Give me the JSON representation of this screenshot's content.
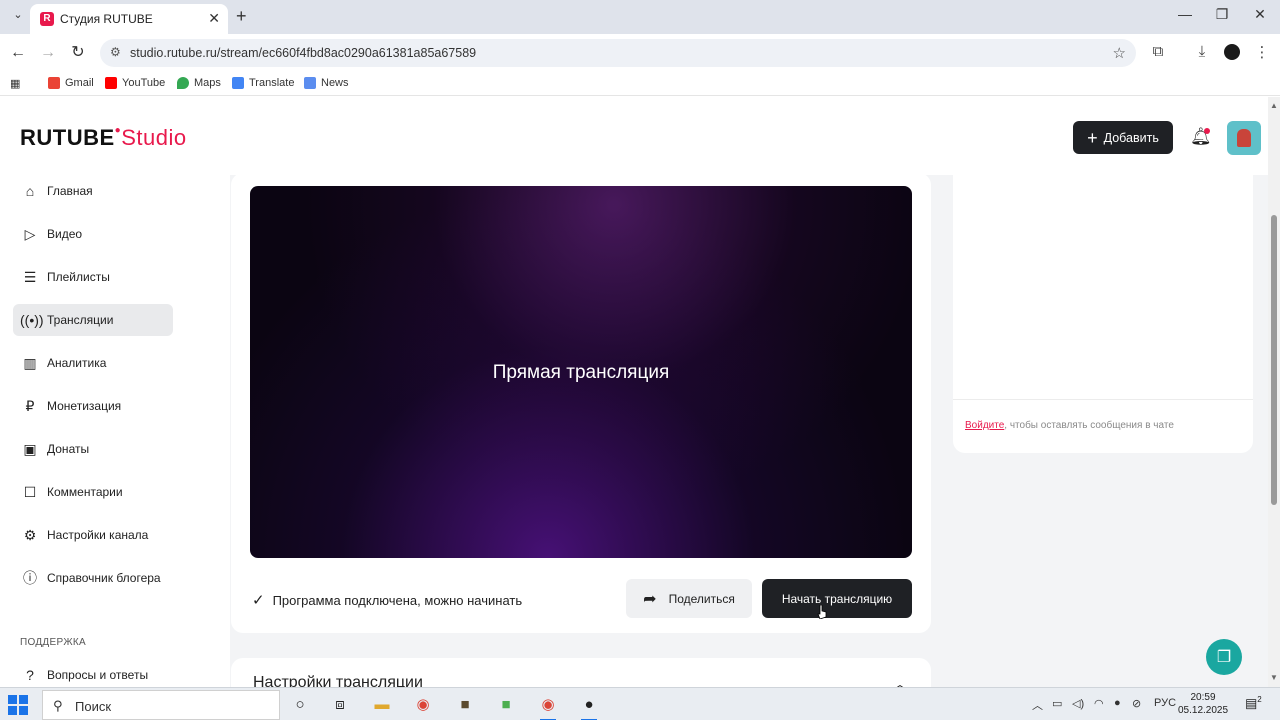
{
  "browser": {
    "tab_title": "Студия RUTUBE",
    "favicon": "R",
    "url": "studio.rutube.ru/stream/ec660f4fbd8ac0290a61381a85a67589",
    "bookmarks": [
      "Gmail",
      "YouTube",
      "Maps",
      "Translate",
      "News"
    ]
  },
  "header": {
    "logo_main": "RUTUBE",
    "logo_sub": "Studio",
    "add_label": "Добавить"
  },
  "sidebar": {
    "items": [
      {
        "label": "Главная",
        "icon": "home-icon"
      },
      {
        "label": "Видео",
        "icon": "video-icon"
      },
      {
        "label": "Плейлисты",
        "icon": "playlist-icon"
      },
      {
        "label": "Трансляции",
        "icon": "broadcast-icon",
        "active": true
      },
      {
        "label": "Аналитика",
        "icon": "analytics-icon"
      },
      {
        "label": "Монетизация",
        "icon": "monetization-icon"
      },
      {
        "label": "Донаты",
        "icon": "donations-icon"
      },
      {
        "label": "Комментарии",
        "icon": "comments-icon"
      },
      {
        "label": "Настройки канала",
        "icon": "settings-icon"
      },
      {
        "label": "Справочник блогера",
        "icon": "info-icon"
      }
    ],
    "support_title": "ПОДДЕРЖКА",
    "support_items": [
      {
        "label": "Вопросы и ответы",
        "icon": "help-icon"
      }
    ]
  },
  "player": {
    "title": "Прямая трансляция"
  },
  "stream": {
    "status": "Программа подключена, можно начинать",
    "share_label": "Поделиться",
    "start_label": "Начать трансляцию"
  },
  "settings": {
    "title": "Настройки трансляции"
  },
  "chat": {
    "login_link": "Войдите",
    "login_note": ", чтобы оставлять сообщения в чате"
  },
  "taskbar": {
    "search_placeholder": "Поиск",
    "language": "РУС",
    "time": "20:59",
    "date": "05.12.2025",
    "notification_count": "2"
  },
  "colors": {
    "accent": "#e8194c",
    "dark_button": "#1f2125",
    "fab": "#1aa7a0"
  }
}
